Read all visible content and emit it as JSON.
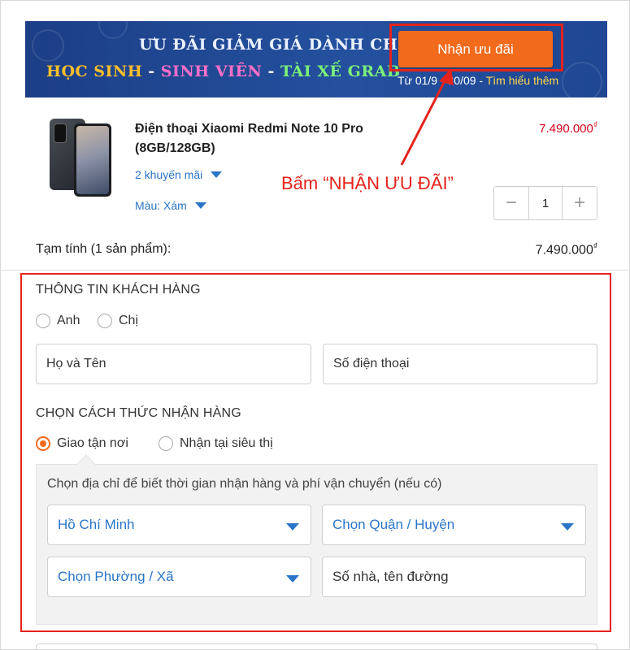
{
  "banner": {
    "headline": "ƯU ĐÃI GIẢM GIÁ DÀNH CHO",
    "audience_1": "HỌC SINH",
    "separator": " - ",
    "audience_2": "SINH VIÊN",
    "audience_3": "TÀI XẾ GRAB",
    "cta_label": "Nhận ưu đãi",
    "date_range": "Từ 01/9 - 30/09 - ",
    "learn_more": "Tìm hiểu thêm",
    "cta_color": "#f26a1b"
  },
  "product": {
    "name": "Điện thoại Xiaomi Redmi Note 10 Pro (8GB/128GB)",
    "price": "7.490.000",
    "currency": "₫",
    "promotions_label": "2 khuyến mãi",
    "color_label": "Màu: Xám",
    "quantity": "1",
    "minus": "−",
    "plus": "+"
  },
  "annotation": {
    "text": "Bấm “NHẬN ƯU ĐÃI”",
    "color": "#e4231b"
  },
  "subtotal": {
    "label": "Tạm tính (1 sản phẩm):",
    "value": "7.490.000"
  },
  "customer": {
    "title": "THÔNG TIN KHÁCH HÀNG",
    "salutation_options": [
      "Anh",
      "Chị"
    ],
    "name_placeholder": "Họ và Tên",
    "phone_placeholder": "Số điện thoại"
  },
  "delivery": {
    "title": "CHỌN CÁCH THỨC NHẬN HÀNG",
    "options": [
      "Giao tận nơi",
      "Nhận tại siêu thị"
    ],
    "selected": "Giao tận nơi",
    "hint": "Chọn địa chỉ để biết thời gian nhận hàng và phí vận chuyển (nếu có)",
    "city": "Hồ Chí Minh",
    "district_placeholder": "Chọn Quận / Huyện",
    "ward_placeholder": "Chọn Phường / Xã",
    "street_placeholder": "Số nhà, tên đường"
  },
  "colors": {
    "accent": "#f26a1b",
    "link": "#2a75c8",
    "price": "#d0021b",
    "highlight": "#e4231b"
  }
}
